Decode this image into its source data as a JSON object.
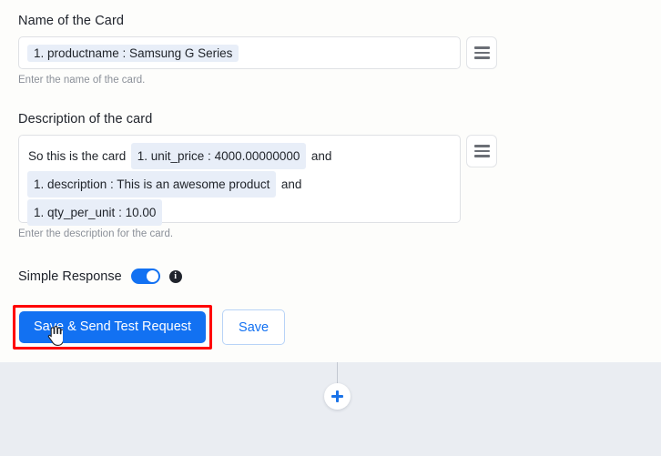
{
  "form": {
    "name_field": {
      "label": "Name of the Card",
      "tokens": [
        {
          "type": "chip",
          "text": "1. productname : Samsung G Series"
        }
      ],
      "help": "Enter the name of the card."
    },
    "description_field": {
      "label": "Description of the card",
      "lines": [
        [
          {
            "type": "text",
            "text": "So this is the card"
          },
          {
            "type": "chip",
            "text": "1. unit_price : 4000.00000000"
          },
          {
            "type": "text",
            "text": "and"
          }
        ],
        [
          {
            "type": "chip",
            "text": "1. description : This is an awesome product"
          },
          {
            "type": "text",
            "text": "and"
          }
        ],
        [
          {
            "type": "chip",
            "text": "1. qty_per_unit : 10.00"
          }
        ]
      ],
      "help": "Enter the description for the card."
    },
    "simple_response": {
      "label": "Simple Response",
      "toggle_state": "on",
      "info_glyph": "i"
    },
    "buttons": {
      "primary": "Save & Send Test Request",
      "secondary": "Save"
    }
  },
  "canvas": {
    "add_node_label": "+"
  },
  "icons": {
    "menu_name_field": "hamburger-menu-icon",
    "menu_description_field": "hamburger-menu-icon"
  },
  "colors": {
    "accent": "#1271f2",
    "chip_bg": "#e8eef8",
    "highlight": "#ff0000",
    "panel_bg": "#fdfdfb",
    "canvas_bg": "#eaedf2"
  }
}
